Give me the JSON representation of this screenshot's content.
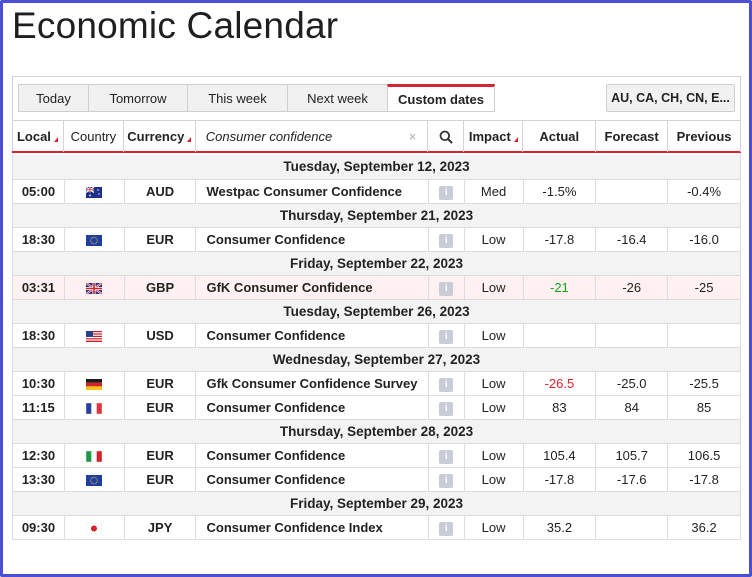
{
  "page": {
    "title": "Economic Calendar"
  },
  "tabs": [
    {
      "label": "Today",
      "active": false
    },
    {
      "label": "Tomorrow",
      "active": false
    },
    {
      "label": "This week",
      "active": false
    },
    {
      "label": "Next week",
      "active": false
    },
    {
      "label": "Custom dates",
      "active": true
    }
  ],
  "region_selector": {
    "label": "AU, CA, CH, CN, E..."
  },
  "columns": {
    "local": "Local",
    "country": "Country",
    "currency": "Currency",
    "impact": "Impact",
    "actual": "Actual",
    "forecast": "Forecast",
    "previous": "Previous"
  },
  "search": {
    "value": "Consumer confidence",
    "clear": "×"
  },
  "colors": {
    "accent": "#d9232e",
    "positive": "#17a21a",
    "negative": "#e0222a",
    "frame": "#4a4fd6"
  },
  "groups": [
    {
      "date": "Tuesday, September 12, 2023",
      "events": [
        {
          "time": "05:00",
          "flag": "au-flag-icon",
          "currency": "AUD",
          "event": "Westpac Consumer Confidence",
          "impact": "Med",
          "actual": "-1.5%",
          "actual_color": "",
          "forecast": "",
          "previous": "-0.4%"
        }
      ]
    },
    {
      "date": "Thursday, September 21, 2023",
      "events": [
        {
          "time": "18:30",
          "flag": "eu-flag-icon",
          "currency": "EUR",
          "event": "Consumer Confidence",
          "impact": "Low",
          "actual": "-17.8",
          "actual_color": "",
          "forecast": "-16.4",
          "previous": "-16.0"
        }
      ]
    },
    {
      "date": "Friday, September 22, 2023",
      "events": [
        {
          "time": "03:31",
          "flag": "uk-flag-icon",
          "currency": "GBP",
          "event": "GfK Consumer Confidence",
          "impact": "Low",
          "actual": "-21",
          "actual_color": "green",
          "forecast": "-26",
          "previous": "-25",
          "highlight": true
        }
      ]
    },
    {
      "date": "Tuesday, September 26, 2023",
      "events": [
        {
          "time": "18:30",
          "flag": "us-flag-icon",
          "currency": "USD",
          "event": "Consumer Confidence",
          "impact": "Low",
          "actual": "",
          "actual_color": "",
          "forecast": "",
          "previous": ""
        }
      ]
    },
    {
      "date": "Wednesday, September 27, 2023",
      "events": [
        {
          "time": "10:30",
          "flag": "de-flag-icon",
          "currency": "EUR",
          "event": "Gfk Consumer Confidence Survey",
          "impact": "Low",
          "actual": "-26.5",
          "actual_color": "red",
          "forecast": "-25.0",
          "previous": "-25.5"
        },
        {
          "time": "11:15",
          "flag": "fr-flag-icon",
          "currency": "EUR",
          "event": "Consumer Confidence",
          "impact": "Low",
          "actual": "83",
          "actual_color": "",
          "forecast": "84",
          "previous": "85"
        }
      ]
    },
    {
      "date": "Thursday, September 28, 2023",
      "events": [
        {
          "time": "12:30",
          "flag": "it-flag-icon",
          "currency": "EUR",
          "event": "Consumer Confidence",
          "impact": "Low",
          "actual": "105.4",
          "actual_color": "",
          "forecast": "105.7",
          "previous": "106.5"
        },
        {
          "time": "13:30",
          "flag": "eu-flag-icon",
          "currency": "EUR",
          "event": "Consumer Confidence",
          "impact": "Low",
          "actual": "-17.8",
          "actual_color": "",
          "forecast": "-17.6",
          "previous": "-17.8"
        }
      ]
    },
    {
      "date": "Friday, September 29, 2023",
      "events": [
        {
          "time": "09:30",
          "flag": "jp-flag-icon",
          "currency": "JPY",
          "event": "Consumer Confidence Index",
          "impact": "Low",
          "actual": "35.2",
          "actual_color": "",
          "forecast": "",
          "previous": "36.2"
        }
      ]
    }
  ]
}
